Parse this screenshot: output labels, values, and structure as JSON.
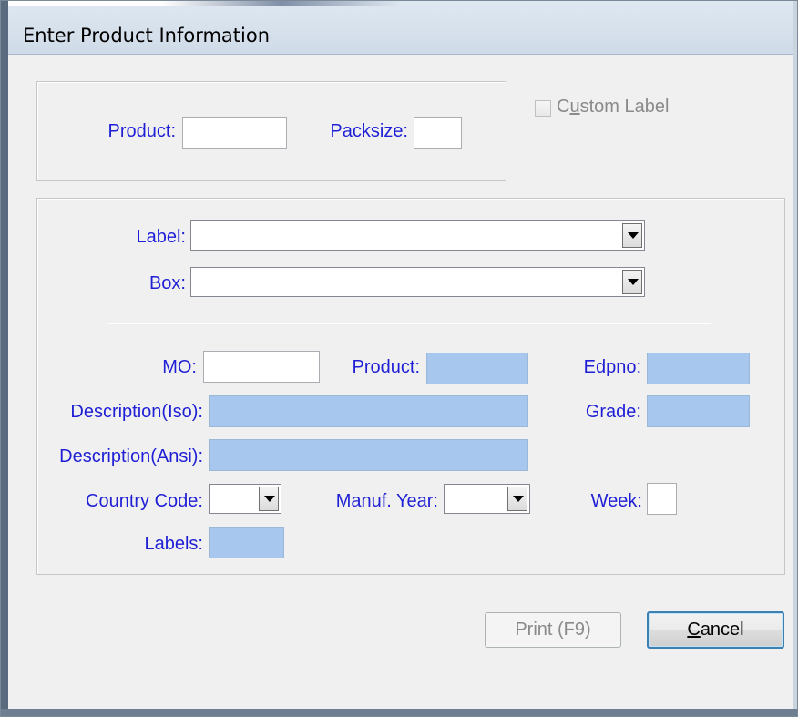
{
  "window": {
    "title": "Enter Product Information"
  },
  "top_group": {
    "product_label": "Product:",
    "product_value": "",
    "packsize_label": "Packsize:",
    "packsize_value": ""
  },
  "custom_label": {
    "prefix": "C",
    "accel": "u",
    "suffix": "stom Label",
    "checked": false
  },
  "main_group": {
    "label_label": "Label:",
    "label_value": "",
    "box_label": "Box:",
    "box_value": "",
    "mo_label": "MO:",
    "mo_value": "",
    "product_label": "Product:",
    "product_value": "",
    "edpno_label": "Edpno:",
    "edpno_value": "",
    "desc_iso_label": "Description(Iso):",
    "desc_iso_value": "",
    "grade_label": "Grade:",
    "grade_value": "",
    "desc_ansi_label": "Description(Ansi):",
    "desc_ansi_value": "",
    "country_code_label": "Country Code:",
    "country_code_value": "",
    "manuf_year_label": "Manuf. Year:",
    "manuf_year_value": "",
    "week_label": "Week:",
    "week_value": "",
    "labels_label": "Labels:",
    "labels_value": ""
  },
  "buttons": {
    "print_label": "Print (F9)",
    "cancel_accel": "C",
    "cancel_rest": "ancel"
  },
  "colors": {
    "label_text": "#1f1fd6",
    "readonly_fill": "#a7c7ee"
  }
}
